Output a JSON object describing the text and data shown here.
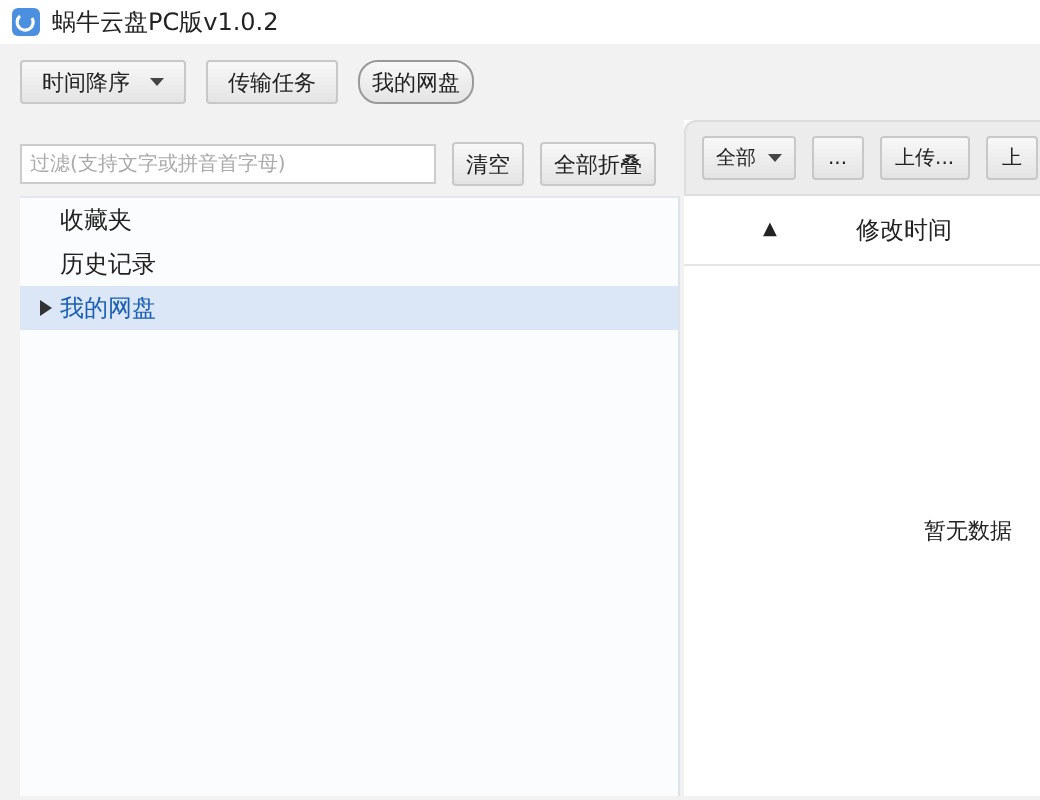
{
  "window": {
    "title": "蜗牛云盘PC版v1.0.2"
  },
  "toolbar": [
    {
      "label": "时间降序",
      "kind": "dropdown"
    },
    {
      "label": "传输任务",
      "kind": "button"
    },
    {
      "label": "我的网盘",
      "kind": "pill"
    }
  ],
  "filter": {
    "placeholder": "过滤(支持文字或拼音首字母)",
    "buttons": [
      "清空",
      "全部折叠"
    ]
  },
  "tree": [
    {
      "label": "收藏夹",
      "kind": "leaf",
      "selected": false
    },
    {
      "label": "历史记录",
      "kind": "leaf",
      "selected": false
    },
    {
      "label": "我的网盘",
      "kind": "folder",
      "expanded": false,
      "selected": true
    }
  ],
  "file_toolbar": [
    {
      "label": "全部",
      "kind": "dropdown"
    },
    {
      "label": "...",
      "kind": "button"
    },
    {
      "label": "上传...",
      "kind": "button"
    },
    {
      "label": "上",
      "kind": "button"
    }
  ],
  "table": {
    "columns": [
      "▲",
      "修改时间"
    ],
    "empty_text": "暂无数据"
  }
}
